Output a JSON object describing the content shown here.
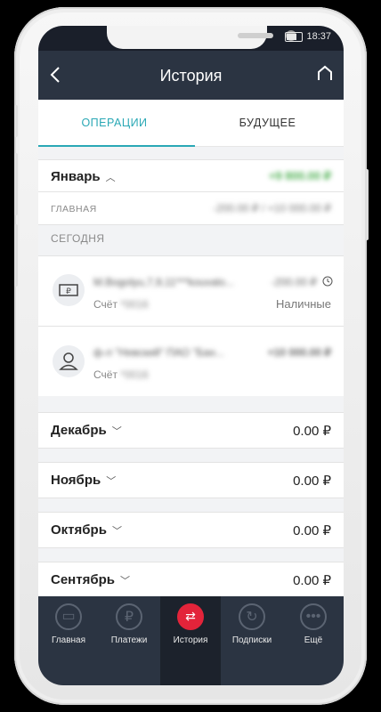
{
  "status": {
    "time": "18:37"
  },
  "header": {
    "back_icon": "chevron-left-icon",
    "title": "История",
    "home_icon": "home-icon"
  },
  "tabs": [
    {
      "label": "ОПЕРАЦИИ",
      "active": true
    },
    {
      "label": "БУДУЩЕЕ",
      "active": false
    }
  ],
  "january": {
    "name": "Январь",
    "total": "+9 800.00 ₽",
    "account_label": "ГЛАВНАЯ",
    "account_sum": "-200.00 ₽ / +10 000.00 ₽"
  },
  "today_label": "СЕГОДНЯ",
  "transactions": [
    {
      "icon": "cash-icon",
      "title": "M.Bogolyu,7,9,11***kouvalo...",
      "account": "Счёт",
      "account_masked": "*0016",
      "amount": "-200.00 ₽",
      "sub": "Наличные"
    },
    {
      "icon": "person-icon",
      "title": "ф-л \"Невский\" ПАО \"Бан...",
      "account": "Счёт",
      "account_masked": "*0016",
      "amount": "+10 000.00 ₽"
    }
  ],
  "months": [
    {
      "name": "Декабрь",
      "amount": "0.00 ₽"
    },
    {
      "name": "Ноябрь",
      "amount": "0.00 ₽"
    },
    {
      "name": "Октябрь",
      "amount": "0.00 ₽"
    },
    {
      "name": "Сентябрь",
      "amount": "0.00 ₽"
    }
  ],
  "bottom_nav": [
    {
      "label": "Главная",
      "icon": "card-icon"
    },
    {
      "label": "Платежи",
      "icon": "ruble-icon"
    },
    {
      "label": "История",
      "icon": "history-arrows-icon",
      "active": true
    },
    {
      "label": "Подписки",
      "icon": "refresh-icon"
    },
    {
      "label": "Ещё",
      "icon": "more-dots-icon"
    }
  ],
  "colors": {
    "accent": "#2aa8b5",
    "header": "#2b3442",
    "active_red": "#e3243a",
    "positive": "#4caf50"
  }
}
